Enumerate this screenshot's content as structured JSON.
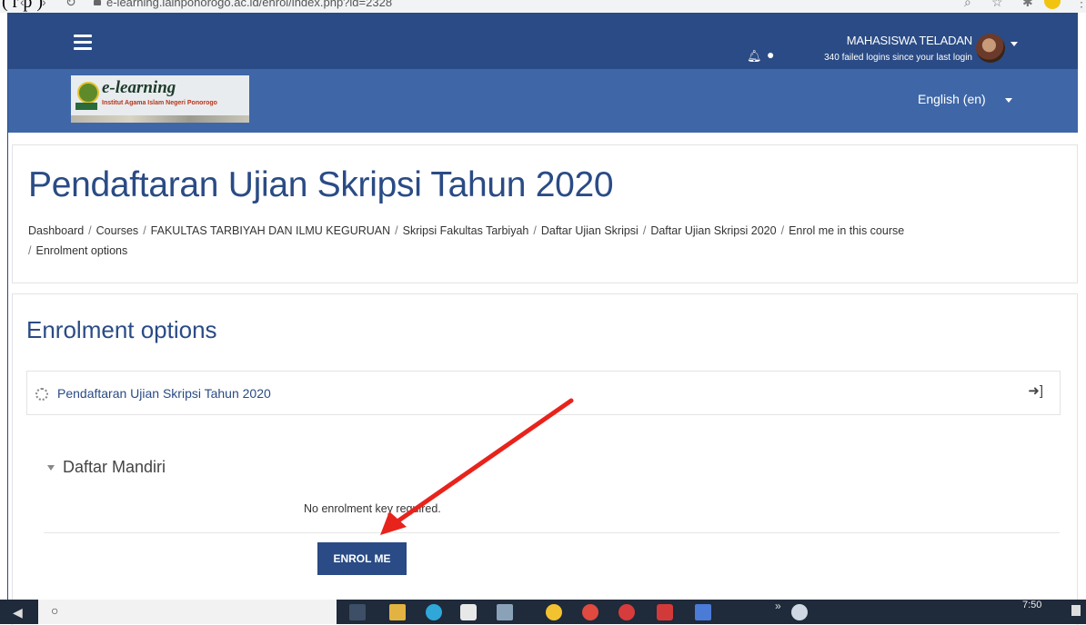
{
  "browser": {
    "caption_fragment": "(        r p      )",
    "url": "e-learning.iainponorogo.ac.id/enrol/index.php?id=2328"
  },
  "navbar": {
    "user_name": "MAHASISWA TELADAN",
    "failed_logins": "340 failed logins since your last login",
    "color": "#2a4b85"
  },
  "brand": {
    "logo_title": "e-learning",
    "logo_subtitle": "Institut Agama Islam Negeri Ponorogo",
    "language": "English (en)",
    "color": "#3f67a8"
  },
  "page": {
    "title": "Pendaftaran Ujian Skripsi Tahun 2020",
    "breadcrumb": [
      "Dashboard",
      "Courses",
      "FAKULTAS TARBIYAH DAN ILMU KEGURUAN",
      "Skripsi Fakultas Tarbiyah",
      "Daftar Ujian Skripsi",
      "Daftar Ujian Skripsi 2020",
      "Enrol me in this course",
      "Enrolment options"
    ]
  },
  "main": {
    "heading": "Enrolment options",
    "course_name": "Pendaftaran Ujian Skripsi Tahun 2020",
    "section_title": "Daftar Mandiri",
    "no_key_text": "No enrolment key required.",
    "enrol_button": "ENROL ME"
  },
  "taskbar": {
    "time": "7:50"
  },
  "colors": {
    "accent": "#2a4b85",
    "annotation_arrow": "#e8231c"
  },
  "icons": [
    "hamburger-icon",
    "bell-icon",
    "chat-icon",
    "caret-down-icon",
    "course-icon",
    "enter-icon",
    "search-icon"
  ]
}
